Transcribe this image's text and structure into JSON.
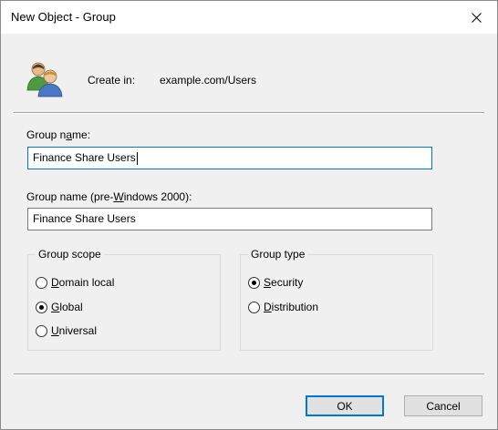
{
  "window": {
    "title": "New Object - Group",
    "close_symbol": "✕"
  },
  "header": {
    "icon": "users-group-icon",
    "create_in_label": "Create in:",
    "create_in_value": "example.com/Users"
  },
  "form": {
    "group_name": {
      "label_pre": "Group n",
      "label_accel": "a",
      "label_post": "me:",
      "value": "Finance Share Users"
    },
    "group_name_pre2000": {
      "label_pre": "Group name (pre-",
      "label_accel": "W",
      "label_post": "indows 2000):",
      "value": "Finance Share Users"
    }
  },
  "group_scope": {
    "title": "Group scope",
    "selected": "Global",
    "options": [
      {
        "pre": "",
        "accel": "D",
        "post": "omain local",
        "checked": false
      },
      {
        "pre": "",
        "accel": "G",
        "post": "lobal",
        "checked": true
      },
      {
        "pre": "",
        "accel": "U",
        "post": "niversal",
        "checked": false
      }
    ]
  },
  "group_type": {
    "title": "Group type",
    "selected": "Security",
    "options": [
      {
        "pre": "",
        "accel": "S",
        "post": "ecurity",
        "checked": true
      },
      {
        "pre": "",
        "accel": "D",
        "post": "istribution",
        "checked": false
      }
    ]
  },
  "buttons": {
    "ok": "OK",
    "cancel": "Cancel"
  }
}
